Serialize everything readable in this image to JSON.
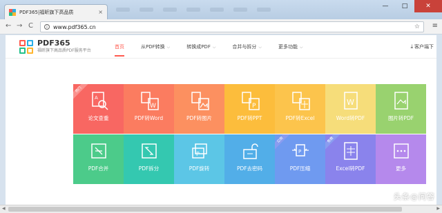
{
  "browser": {
    "tab_title": "PDF365|福昕旗下高品质",
    "tab_close": "×",
    "url": "www.pdf365.cn",
    "back": "←",
    "forward": "→",
    "reload": "C",
    "star": "☆",
    "menu": "≡",
    "win_min": "—",
    "win_max": "□",
    "win_close": "✕"
  },
  "site": {
    "logo_name": "PDF365",
    "logo_slogan": "福昕旗下高品质PDF服务平台",
    "logo_colors": [
      "#ff5a4e",
      "#2aaee6",
      "#22c08a",
      "#ffb52e"
    ],
    "nav": [
      {
        "label": "首页",
        "active": true
      },
      {
        "label": "从PDF转换",
        "chevron": "⌵"
      },
      {
        "label": "转换成PDF",
        "chevron": "⌵"
      },
      {
        "label": "合并与拆分",
        "chevron": "⌵"
      },
      {
        "label": "更多功能",
        "chevron": "⌵"
      }
    ],
    "client_download": "客户端下"
  },
  "tiles": [
    {
      "label": "论文查重",
      "icon": "search-doc-icon",
      "color": "#f86762",
      "ribbon": "热门"
    },
    {
      "label": "PDF转Word",
      "icon": "pdf-to-word-icon",
      "color": "#fb7c60"
    },
    {
      "label": "PDF转图片",
      "icon": "pdf-to-image-icon",
      "color": "#fc9060"
    },
    {
      "label": "PDF转PPT",
      "icon": "pdf-to-ppt-icon",
      "color": "#fcbd3c"
    },
    {
      "label": "PDF转Excel",
      "icon": "pdf-to-excel-icon",
      "color": "#fcc44c"
    },
    {
      "label": "Word转PDF",
      "icon": "word-to-pdf-icon",
      "color": "#f6dd7a"
    },
    {
      "label": "图片转PDF",
      "icon": "image-to-pdf-icon",
      "color": "#99d26f"
    },
    {
      "label": "PDF合并",
      "icon": "merge-icon",
      "color": "#4ccb8a"
    },
    {
      "label": "PDF拆分",
      "icon": "split-icon",
      "color": "#34c8b0"
    },
    {
      "label": "PDF旋转",
      "icon": "rotate-icon",
      "color": "#5cc6e6"
    },
    {
      "label": "PDF去密码",
      "icon": "unlock-icon",
      "color": "#52aee8"
    },
    {
      "label": "PDF压缩",
      "icon": "compress-icon",
      "color": "#6f9af0",
      "ribbon": "公测"
    },
    {
      "label": "Excel转PDF",
      "icon": "excel-to-pdf-icon",
      "color": "#8a83ec",
      "ribbon": "免费"
    },
    {
      "label": "更多",
      "icon": "more-icon",
      "color": "#b589ec"
    }
  ],
  "watermark": "头条@问答"
}
